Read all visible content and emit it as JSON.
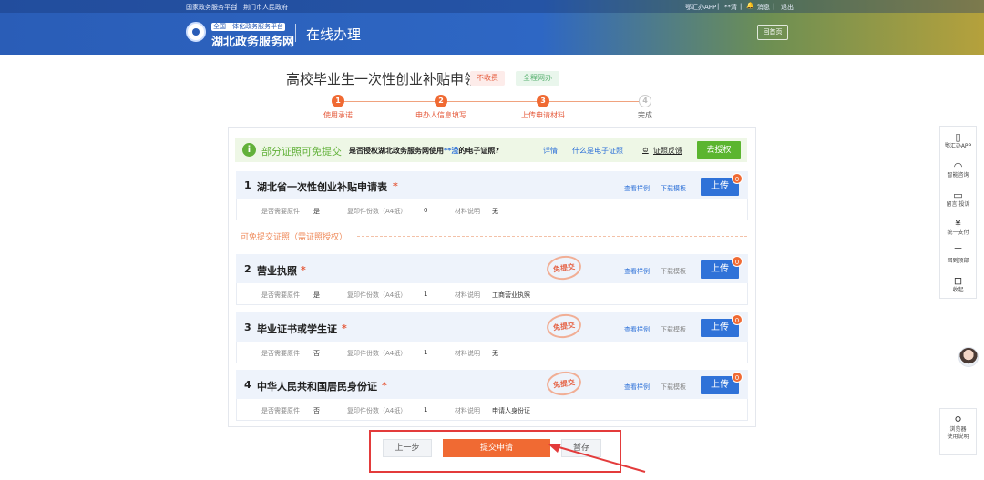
{
  "header": {
    "top_links": [
      "国家政务服务平台",
      "荆门市人民政府"
    ],
    "right_links": [
      "鄂汇办APP",
      "**清",
      "消息",
      "退出"
    ],
    "logo_sub": "全国一体化政务服务平台",
    "logo_main": "湖北政务服务网",
    "section": "在线办理",
    "home_button": "回首页"
  },
  "title": {
    "text": "高校毕业生一次性创业补贴申领",
    "tag_fee": "不收费",
    "tag_online": "全程网办"
  },
  "steps": [
    {
      "num": "1",
      "label": "使用承诺",
      "done": true
    },
    {
      "num": "2",
      "label": "申办人信息填写",
      "done": true
    },
    {
      "num": "3",
      "label": "上传申请材料",
      "done": true
    },
    {
      "num": "4",
      "label": "完成",
      "done": false
    }
  ],
  "notice": {
    "icon": "i",
    "title": "部分证照可免提交",
    "question_pre": "是否授权湖北政务服务网使用",
    "question_name": "**滢",
    "question_post": "的电子证照?",
    "link_detail": "详情",
    "link_what": "什么是电子证照",
    "feedback": "证照反馈",
    "authorize": "去授权"
  },
  "meta_keys": {
    "original": "是否需要原件",
    "copies": "复印件份数（A4纸）",
    "desc": "材料说明"
  },
  "materials": [
    {
      "num": "1",
      "name": "湖北省一次性创业补贴申请表",
      "required": "*",
      "view_sample": "查看样例",
      "download": "下载模板",
      "upload": "上传",
      "count": "0",
      "original": "是",
      "copies": "0",
      "desc": "无"
    },
    {
      "num": "2",
      "name": "营业执照",
      "required": "*",
      "stamp": "免提交",
      "view_sample": "查看样例",
      "download": "下载模板",
      "upload": "上传",
      "count": "0",
      "original": "是",
      "copies": "1",
      "desc": "工商营业执照"
    },
    {
      "num": "3",
      "name": "毕业证书或学生证",
      "required": "*",
      "stamp": "免提交",
      "view_sample": "查看样例",
      "download": "下载模板",
      "upload": "上传",
      "count": "0",
      "original": "否",
      "copies": "1",
      "desc": "无"
    },
    {
      "num": "4",
      "name": "中华人民共和国居民身份证",
      "required": "*",
      "stamp": "免提交",
      "view_sample": "查看样例",
      "download": "下载模板",
      "upload": "上传",
      "count": "0",
      "original": "否",
      "copies": "1",
      "desc": "申请人身份证"
    }
  ],
  "exempt_section": "可免提交证照（需证照授权）",
  "buttons": {
    "prev": "上一步",
    "submit": "提交申请",
    "save": "暂存"
  },
  "dock": [
    {
      "icon": "phone-icon",
      "glyph": "▯",
      "label": "鄂汇办APP"
    },
    {
      "icon": "headset-icon",
      "glyph": "◠",
      "label": "智能咨询"
    },
    {
      "icon": "message-icon",
      "glyph": "▭",
      "label": "留言 投诉"
    },
    {
      "icon": "yen-icon",
      "glyph": "¥",
      "label": "统一支付"
    },
    {
      "icon": "back-to-top-icon",
      "glyph": "⊤",
      "label": "回到顶部"
    },
    {
      "icon": "collapse-icon",
      "glyph": "⊟",
      "label": "收起"
    }
  ],
  "dock2": {
    "icon": "browser-icon",
    "glyph": "⚲",
    "label_1": "浏览器",
    "label_2": "使用说明"
  }
}
